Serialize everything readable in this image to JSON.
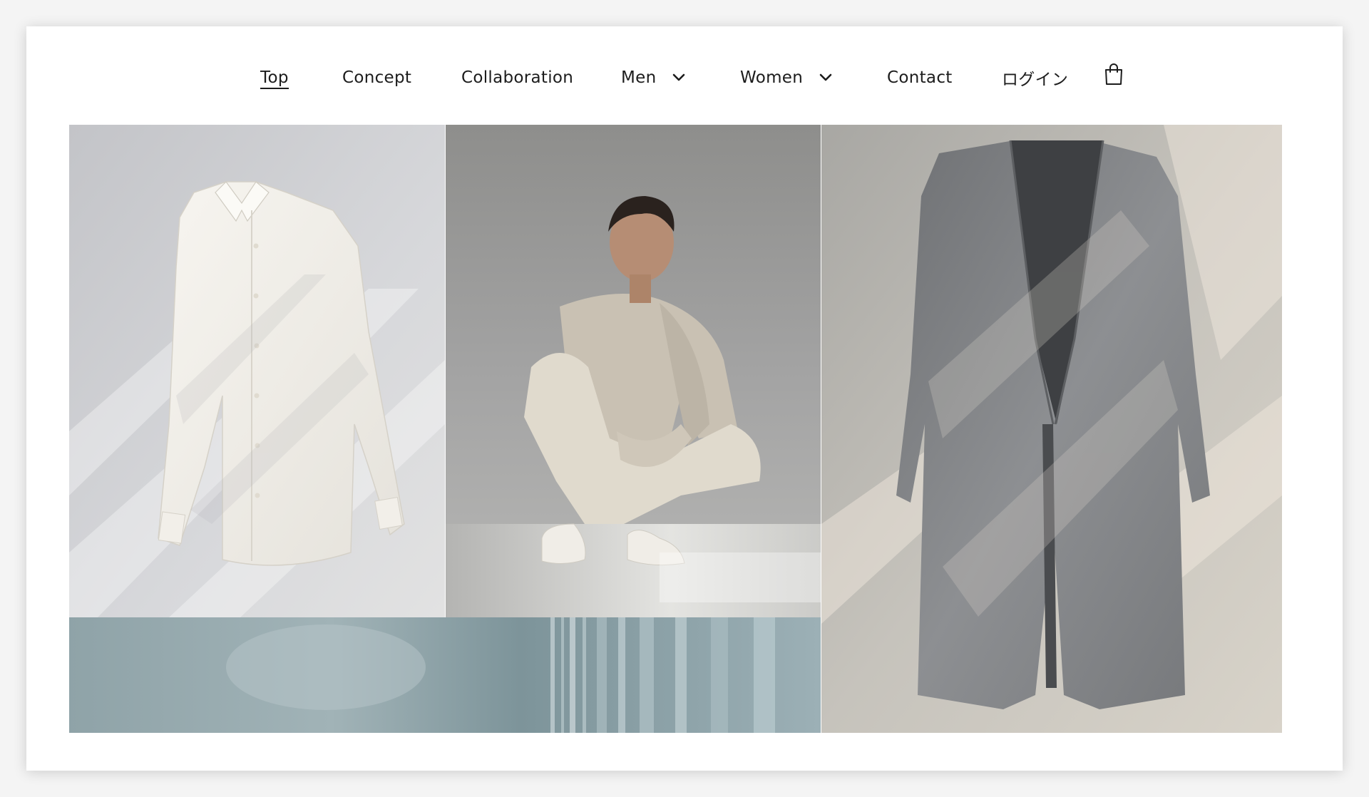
{
  "nav": {
    "items": [
      {
        "label": "Top",
        "active": true
      },
      {
        "label": "Concept"
      },
      {
        "label": "Collaboration"
      },
      {
        "label": "Men",
        "dropdown": true
      },
      {
        "label": "Women",
        "dropdown": true
      },
      {
        "label": "Contact"
      },
      {
        "label": "ログイン"
      }
    ],
    "cart_icon": "shopping-bag-icon"
  },
  "gallery": {
    "panels": [
      {
        "name": "white-shirt-photo"
      },
      {
        "name": "model-photo"
      },
      {
        "name": "blue-curtain-photo"
      },
      {
        "name": "grey-coat-photo"
      }
    ]
  },
  "colors": {
    "text": "#1c1c1c",
    "page_background": "#ffffff",
    "frame_background": "#f4f4f4"
  }
}
